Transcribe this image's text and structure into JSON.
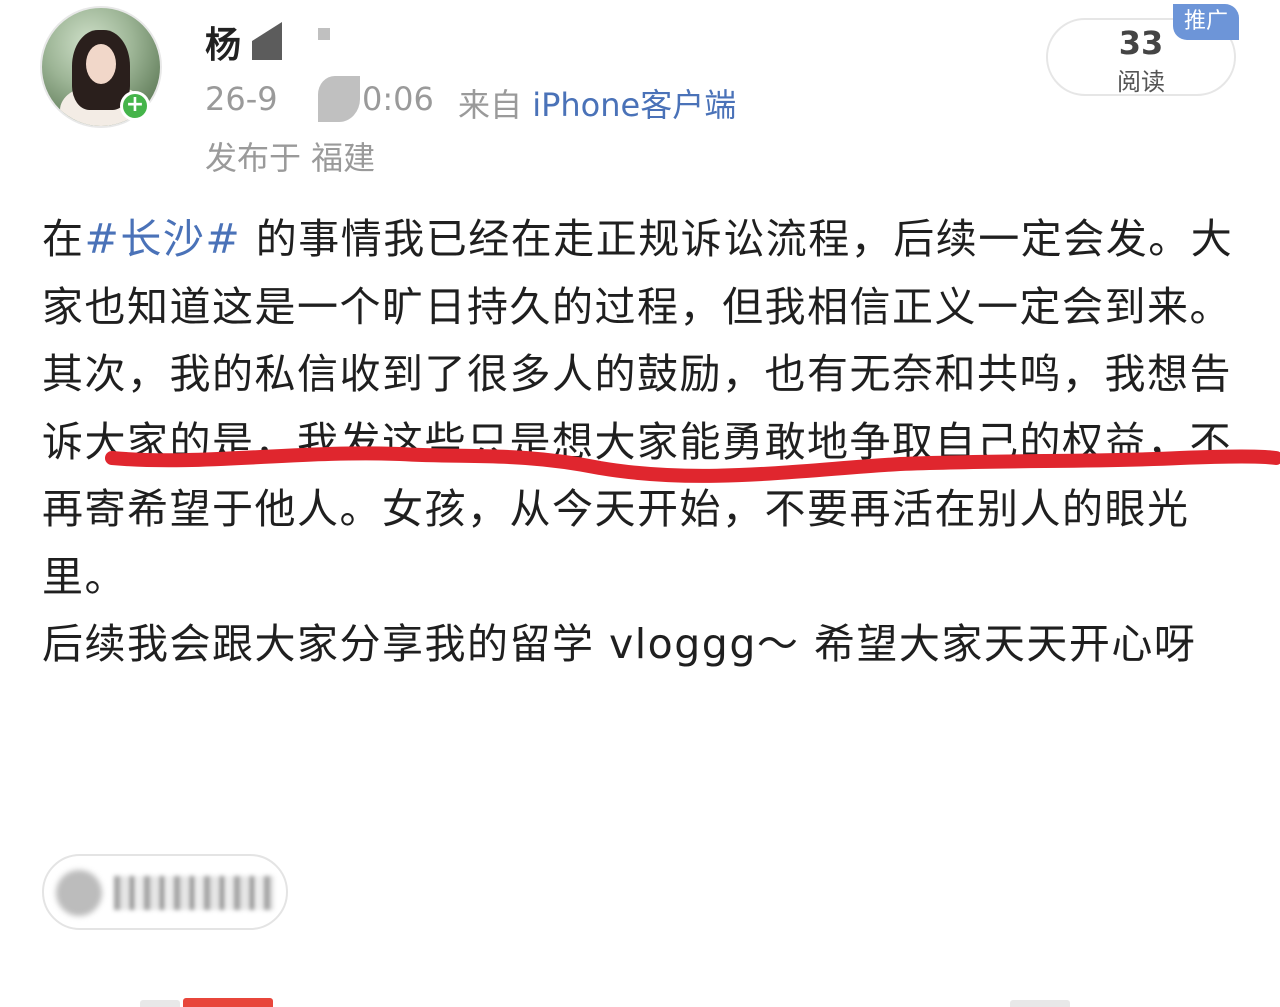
{
  "post": {
    "username": "杨",
    "date_fragment": "26-9",
    "time_fragment": "0:06",
    "source_prefix": "来自",
    "source_client": "iPhone客户端",
    "location": "发布于 福建",
    "read_count": "33",
    "read_label": "阅读",
    "promo_tag": "推广",
    "paragraphs": [
      {
        "lead": "在",
        "hashtag": "#长沙#",
        "rest": " 的事情我已经在走正规诉讼流程，后续一定会发。大家也知道这是一个旷日持久的过程，但我相信正义一定会到来。"
      },
      {
        "text": "其次，我的私信收到了很多人的鼓励，也有无奈和共鸣，我想告诉大家的是，我发这些只是想大家能勇敢地争取自己的权益，不再寄希望于他人。女孩，从今天开始，不要再活在别人的眼光里。"
      },
      {
        "text": "后续我会跟大家分享我的留学 vloggg～ 希望大家天天开心呀"
      }
    ]
  },
  "colors": {
    "link_blue": "#4a72b8",
    "annotation_red": "#e0262e",
    "meta_grey": "#9a9a9a",
    "follow_green": "#45b44a",
    "promo_blue": "#6d95d8"
  },
  "icons": {
    "follow": "plus-icon"
  }
}
